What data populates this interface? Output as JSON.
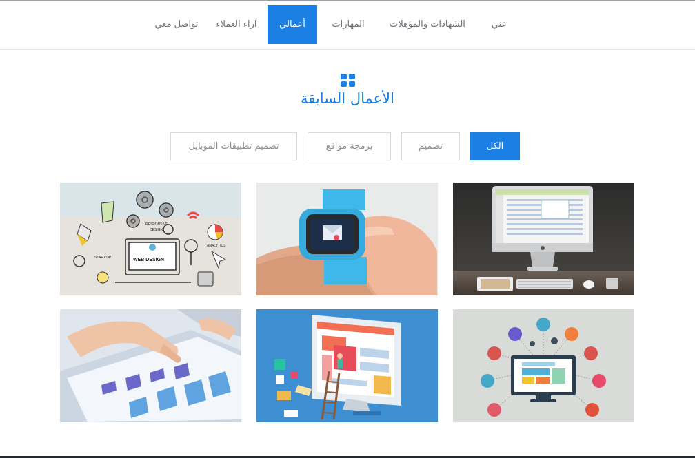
{
  "nav": {
    "items": [
      {
        "label": "عني"
      },
      {
        "label": "الشهادات والمؤهلات"
      },
      {
        "label": "المهارات"
      },
      {
        "label": "أعمالي",
        "active": true
      },
      {
        "label": "آراء العملاء"
      },
      {
        "label": "تواصل معي"
      }
    ]
  },
  "section": {
    "icon": "grid-icon",
    "title": "الأعمال السابقة"
  },
  "filters": [
    {
      "label": "الكل",
      "active": true
    },
    {
      "label": "تصميم"
    },
    {
      "label": "برمجة مواقع"
    },
    {
      "label": "تصميم تطبيقات الموبايل"
    }
  ],
  "portfolio": {
    "items": [
      {
        "name": "imac-desk-photo"
      },
      {
        "name": "smartwatch-photo"
      },
      {
        "name": "web-design-sketch"
      },
      {
        "name": "connected-devices-illustration"
      },
      {
        "name": "website-builder-illustration"
      },
      {
        "name": "tablet-chart-photo"
      }
    ],
    "image_texts": {
      "responsive": "RESPONSIVE",
      "design": "DESIGN",
      "web_design": "WEB DESIGN",
      "startup": "START UP",
      "analytics": "ANALYTICS"
    }
  },
  "colors": {
    "accent": "#1b7fe3",
    "nav_text": "#6b7278",
    "filter_text": "#8a8f94"
  }
}
